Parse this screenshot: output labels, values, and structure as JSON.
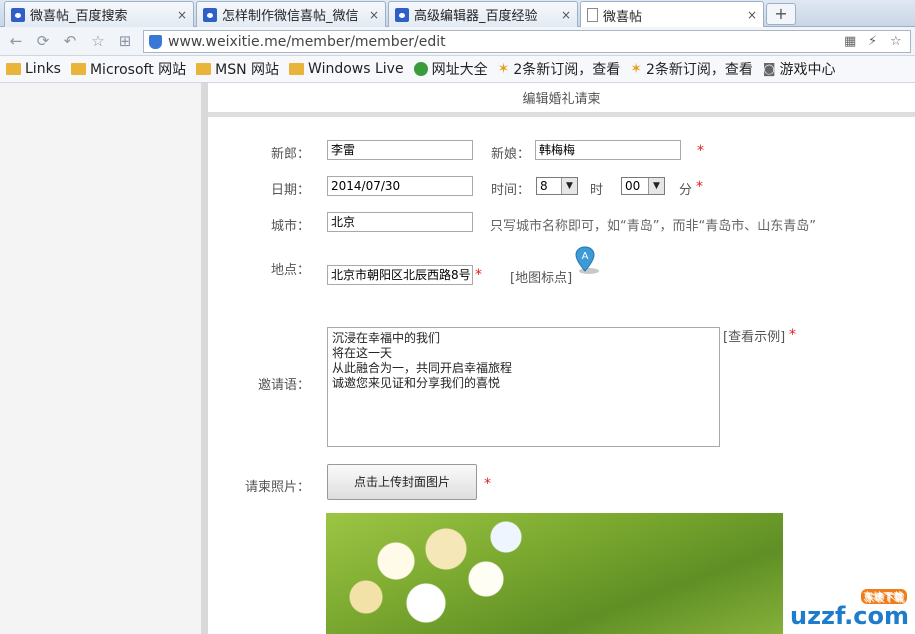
{
  "tabs": [
    {
      "title": "微喜帖_百度搜索",
      "icon": "baidu-paw-icon",
      "close": "×"
    },
    {
      "title": "怎样制作微信喜帖_微信",
      "icon": "baidu-paw-icon",
      "close": "×"
    },
    {
      "title": "高级编辑器_百度经验",
      "icon": "baidu-paw-icon",
      "close": "×"
    },
    {
      "title": "微喜帖",
      "icon": "page-icon",
      "close": "×"
    }
  ],
  "new_tab": "+",
  "address": {
    "url": "www.weixitie.me/member/member/edit",
    "nav": [
      "←",
      "⟳",
      "↶",
      "☆",
      "⊞"
    ],
    "right": [
      "▦",
      "⚡",
      "☆"
    ]
  },
  "bookmarks": [
    {
      "label": "Links",
      "icon": "folder-icon"
    },
    {
      "label": "Microsoft 网站",
      "icon": "folder-icon"
    },
    {
      "label": "MSN 网站",
      "icon": "folder-icon"
    },
    {
      "label": "Windows Live",
      "icon": "folder-icon"
    },
    {
      "label": "网址大全",
      "icon": "globe-icon"
    },
    {
      "label": "2条新订阅，查看",
      "icon": "rss-icon"
    },
    {
      "label": "2条新订阅，查看",
      "icon": "rss-icon"
    },
    {
      "label": "游戏中心",
      "icon": "gamepad-icon"
    }
  ],
  "form": {
    "header": "编辑婚礼请柬",
    "groom_label": "新郎：",
    "groom_value": "李雷",
    "bride_label": "新娘：",
    "bride_value": "韩梅梅",
    "date_label": "日期：",
    "date_value": "2014/07/30",
    "time_label": "时间：",
    "hour_value": "8",
    "hour_unit": "时",
    "minute_value": "00",
    "minute_unit": "分",
    "city_label": "城市：",
    "city_value": "北京",
    "city_hint": "只写城市名称即可，如“青岛”，而非“青岛市、山东青岛”",
    "place_label": "地点：",
    "place_value": "北京市朝阳区北辰西路8号",
    "map_link": "[地图标点]",
    "invite_label": "邀请语：",
    "invite_lines": [
      "沉浸在幸福中的我们",
      "将在这一天",
      "从此融合为一，共同开启幸福旅程",
      "诚邀您来见证和分享我们的喜悦"
    ],
    "example_link": "[查看示例]",
    "photo_label": "请柬照片：",
    "upload_button": "点击上传封面图片",
    "required_mark": "*",
    "select_arrow": "▼"
  },
  "watermark": {
    "main": "uzzf.com",
    "sub": "东坡下载"
  },
  "colors": {
    "required": "#e02020",
    "accent": "#1d7ccb"
  }
}
